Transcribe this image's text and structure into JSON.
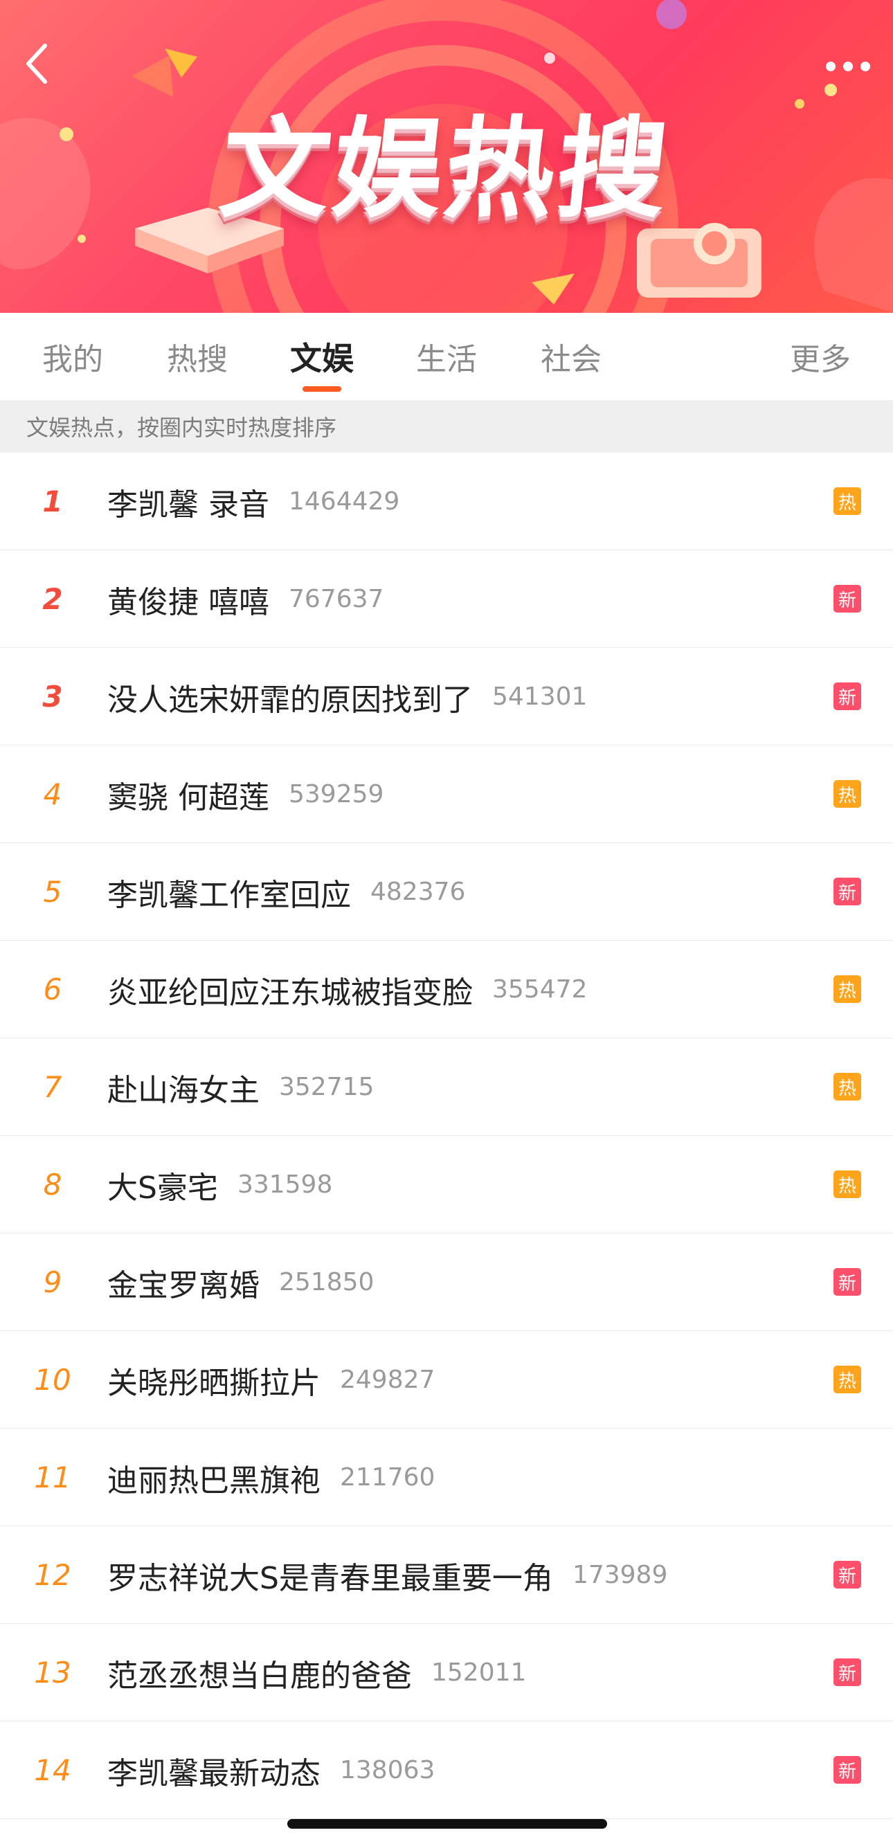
{
  "banner": {
    "title": "文娱热搜",
    "colors": {
      "primary": "#ff3b5c",
      "accent": "#ffa41b"
    }
  },
  "tabs": [
    {
      "label": "我的"
    },
    {
      "label": "热搜"
    },
    {
      "label": "文娱",
      "active": true
    },
    {
      "label": "生活"
    },
    {
      "label": "社会"
    },
    {
      "label": "更多"
    }
  ],
  "subheader": {
    "text": "文娱热点，按圈内实时热度排序"
  },
  "list": [
    {
      "rank": "1",
      "title": "李凯馨 录音",
      "count": "1464429",
      "badge": "热",
      "badge_type": "hot"
    },
    {
      "rank": "2",
      "title": "黄俊捷 嘻嘻",
      "count": "767637",
      "badge": "新",
      "badge_type": "new"
    },
    {
      "rank": "3",
      "title": "没人选宋妍霏的原因找到了",
      "count": "541301",
      "badge": "新",
      "badge_type": "new"
    },
    {
      "rank": "4",
      "title": "窦骁 何超莲",
      "count": "539259",
      "badge": "热",
      "badge_type": "hot"
    },
    {
      "rank": "5",
      "title": "李凯馨工作室回应",
      "count": "482376",
      "badge": "新",
      "badge_type": "new"
    },
    {
      "rank": "6",
      "title": "炎亚纶回应汪东城被指变脸",
      "count": "355472",
      "badge": "热",
      "badge_type": "hot"
    },
    {
      "rank": "7",
      "title": "赴山海女主",
      "count": "352715",
      "badge": "热",
      "badge_type": "hot"
    },
    {
      "rank": "8",
      "title": "大S豪宅",
      "count": "331598",
      "badge": "热",
      "badge_type": "hot"
    },
    {
      "rank": "9",
      "title": "金宝罗离婚",
      "count": "251850",
      "badge": "新",
      "badge_type": "new"
    },
    {
      "rank": "10",
      "title": "关晓彤晒撕拉片",
      "count": "249827",
      "badge": "热",
      "badge_type": "hot"
    },
    {
      "rank": "11",
      "title": "迪丽热巴黑旗袍",
      "count": "211760",
      "badge": "",
      "badge_type": "none"
    },
    {
      "rank": "12",
      "title": "罗志祥说大S是青春里最重要一角",
      "count": "173989",
      "badge": "新",
      "badge_type": "new"
    },
    {
      "rank": "13",
      "title": "范丞丞想当白鹿的爸爸",
      "count": "152011",
      "badge": "新",
      "badge_type": "new"
    },
    {
      "rank": "14",
      "title": "李凯馨最新动态",
      "count": "138063",
      "badge": "新",
      "badge_type": "new"
    }
  ]
}
